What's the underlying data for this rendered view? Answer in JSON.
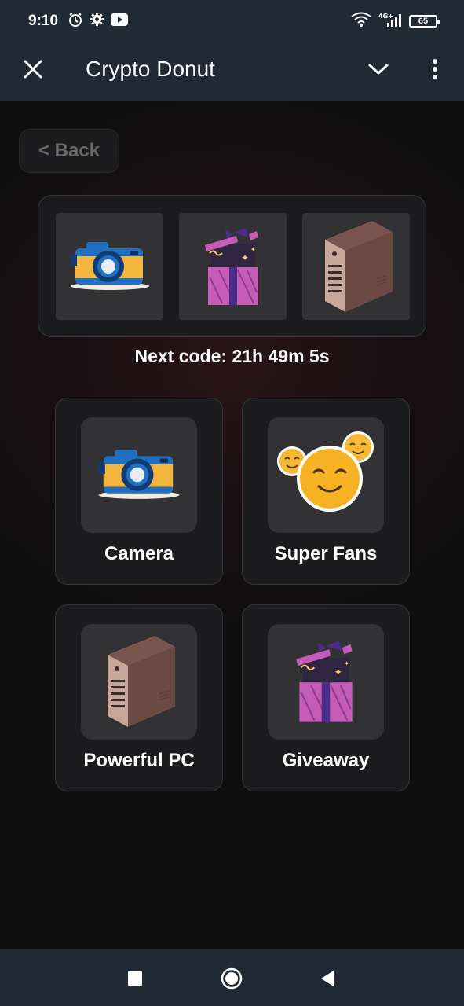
{
  "status_bar": {
    "time": "9:10",
    "battery": "65",
    "icons": [
      "alarm-icon",
      "settings-icon",
      "youtube-icon",
      "wifi-icon",
      "signal-icon",
      "battery-icon"
    ],
    "network_label": "4G+"
  },
  "app_bar": {
    "title": "Crypto Donut",
    "close_icon": "close-icon",
    "dropdown_icon": "chevron-down-icon",
    "menu_icon": "more-vert-icon"
  },
  "back_button": {
    "label": "< Back"
  },
  "strip": {
    "items": [
      {
        "icon": "camera-icon"
      },
      {
        "icon": "gift-box-icon"
      },
      {
        "icon": "pc-tower-icon"
      }
    ]
  },
  "next_code": {
    "text": "Next code: 21h 49m 5s"
  },
  "cards": [
    {
      "label": "Camera",
      "icon": "camera-icon"
    },
    {
      "label": "Super Fans",
      "icon": "smiley-faces-icon"
    },
    {
      "label": "Powerful PC",
      "icon": "pc-tower-icon"
    },
    {
      "label": "Giveaway",
      "icon": "gift-box-icon"
    }
  ],
  "nav_bar": {
    "buttons": [
      "recents-square-icon",
      "home-circle-icon",
      "back-triangle-icon"
    ]
  },
  "colors": {
    "system_bar": "#1f2a35",
    "background": "#0f0f10",
    "card_bg": "#1c1c1f",
    "slot_bg": "#323234",
    "back_text": "#6a6a6a"
  }
}
